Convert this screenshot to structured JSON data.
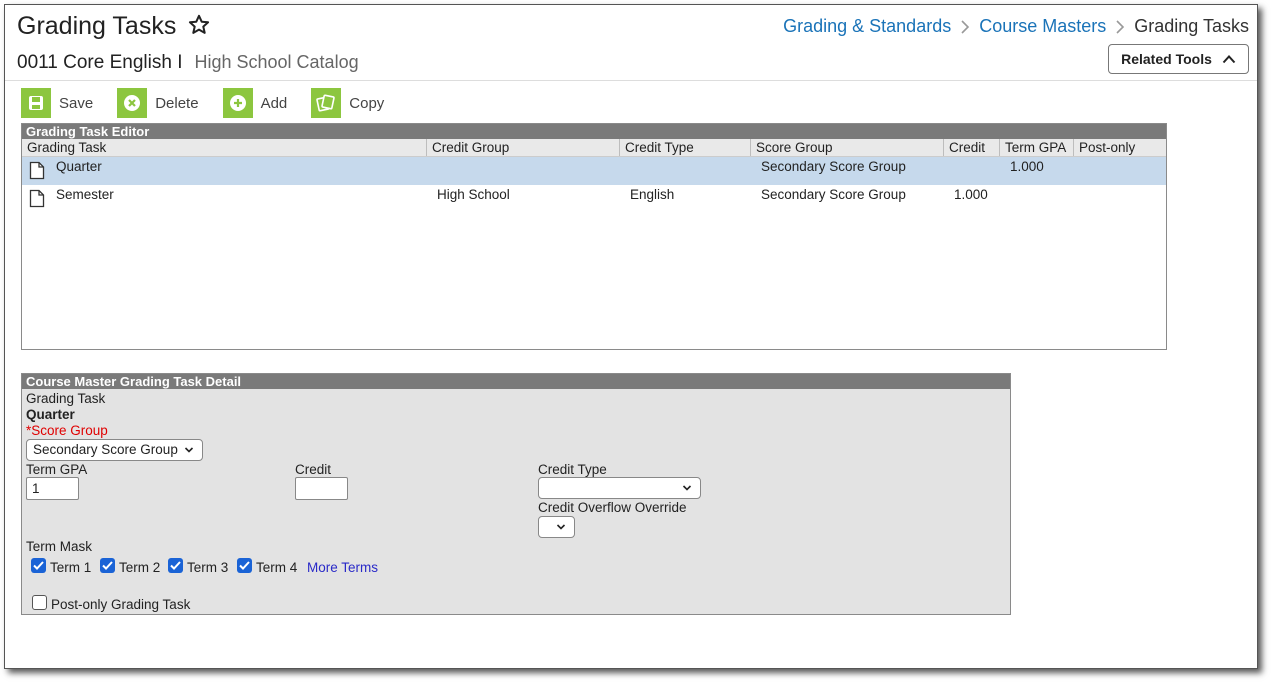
{
  "header": {
    "title": "Grading Tasks",
    "star_icon": "star-outline-icon",
    "breadcrumb": [
      "Grading & Standards",
      "Course Masters",
      "Grading Tasks"
    ],
    "subtitle": "0011 Core English I",
    "catalog": "High School Catalog",
    "related_tools": "Related Tools"
  },
  "toolbar": {
    "save": "Save",
    "delete": "Delete",
    "add": "Add",
    "copy": "Copy"
  },
  "editor": {
    "title": "Grading Task Editor",
    "columns": [
      "Grading Task",
      "Credit Group",
      "Credit Type",
      "Score Group",
      "Credit",
      "Term GPA",
      "Post-only"
    ],
    "rows": [
      {
        "task": "Quarter",
        "credit_group": "",
        "credit_type": "",
        "score_group": "Secondary Score Group",
        "credit": "",
        "term_gpa": "1.000",
        "post_only": "",
        "selected": true
      },
      {
        "task": "Semester",
        "credit_group": "High School",
        "credit_type": "English",
        "score_group": "Secondary Score Group",
        "credit": "1.000",
        "term_gpa": "",
        "post_only": "",
        "selected": false
      }
    ]
  },
  "detail": {
    "title": "Course Master Grading Task Detail",
    "grading_task_label": "Grading Task",
    "grading_task_value": "Quarter",
    "score_group_required": "*",
    "score_group_label": "Score Group",
    "score_group_value": "Secondary Score Group",
    "term_gpa_label": "Term GPA",
    "term_gpa_value": "1",
    "credit_label": "Credit",
    "credit_value": "",
    "credit_type_label": "Credit Type",
    "credit_type_value": "",
    "credit_overflow_label": "Credit Overflow Override",
    "credit_overflow_value": "",
    "term_mask_label": "Term Mask",
    "terms": [
      {
        "label": "Term 1",
        "checked": true
      },
      {
        "label": "Term 2",
        "checked": true
      },
      {
        "label": "Term 3",
        "checked": true
      },
      {
        "label": "Term 4",
        "checked": true
      }
    ],
    "more_terms": "More Terms",
    "post_only_label": "Post-only Grading Task",
    "post_only_checked": false
  },
  "colors": {
    "accent_green": "#8cc63f",
    "link_blue": "#1a73b8",
    "panel_header": "#7a7a7a",
    "selected_row": "#c6d9ec",
    "checkbox_blue": "#1a63d6",
    "required_red": "#e00000"
  }
}
